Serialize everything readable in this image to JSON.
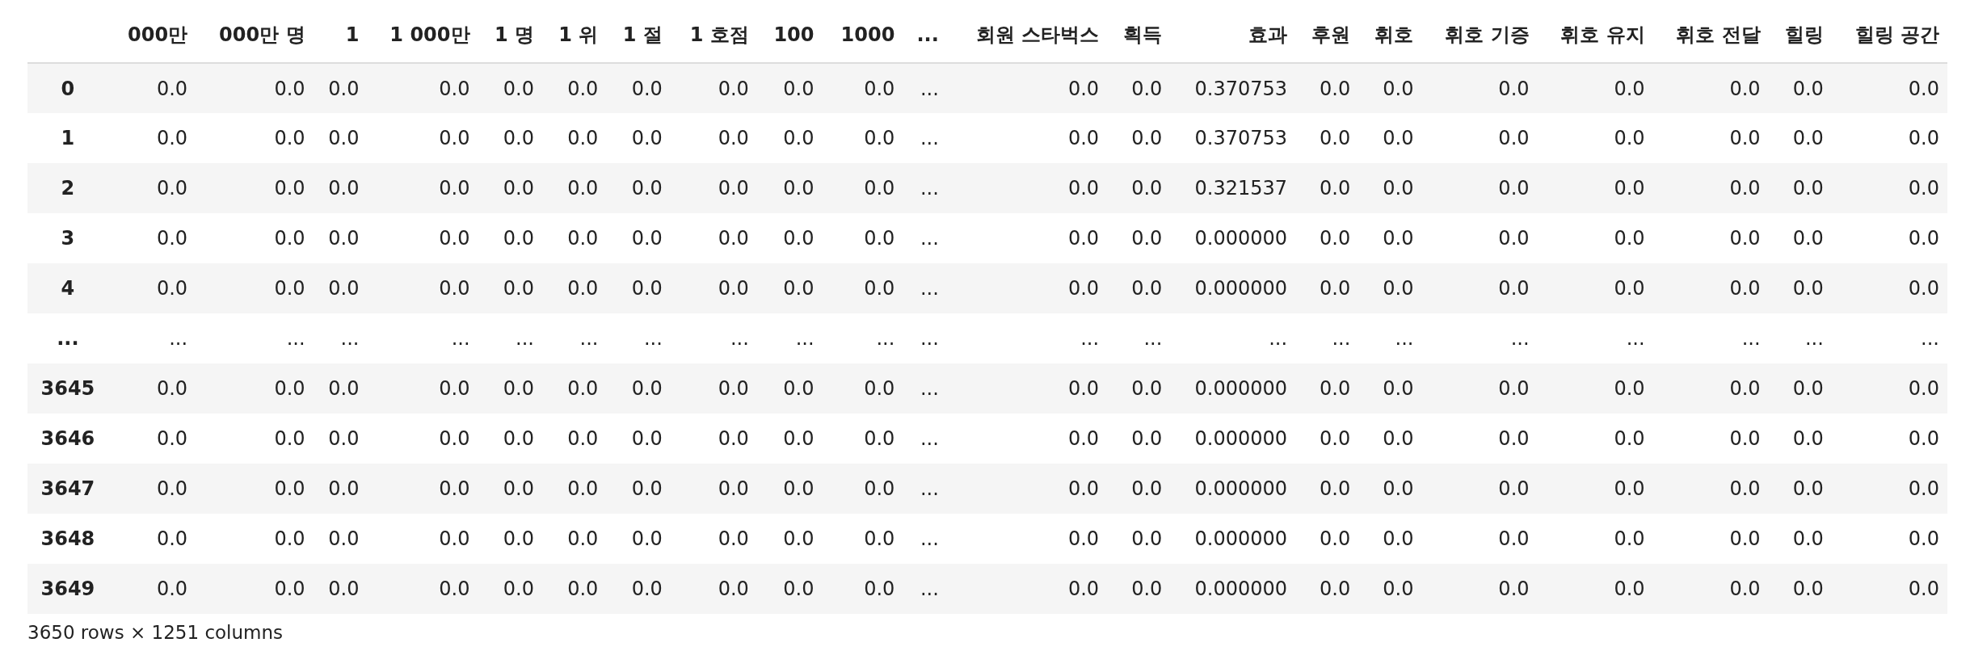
{
  "table": {
    "columns": [
      "000만",
      "000만 명",
      "1",
      "1 000만",
      "1 명",
      "1 위",
      "1 절",
      "1 호점",
      "100",
      "1000",
      "...",
      "회원 스타벅스",
      "획득",
      "효과",
      "후원",
      "휘호",
      "휘호 기증",
      "휘호 유지",
      "휘호 전달",
      "힐링",
      "힐링 공간"
    ],
    "rows": [
      {
        "index": "0",
        "cells": [
          "0.0",
          "0.0",
          "0.0",
          "0.0",
          "0.0",
          "0.0",
          "0.0",
          "0.0",
          "0.0",
          "0.0",
          "...",
          "0.0",
          "0.0",
          "0.370753",
          "0.0",
          "0.0",
          "0.0",
          "0.0",
          "0.0",
          "0.0",
          "0.0"
        ]
      },
      {
        "index": "1",
        "cells": [
          "0.0",
          "0.0",
          "0.0",
          "0.0",
          "0.0",
          "0.0",
          "0.0",
          "0.0",
          "0.0",
          "0.0",
          "...",
          "0.0",
          "0.0",
          "0.370753",
          "0.0",
          "0.0",
          "0.0",
          "0.0",
          "0.0",
          "0.0",
          "0.0"
        ]
      },
      {
        "index": "2",
        "cells": [
          "0.0",
          "0.0",
          "0.0",
          "0.0",
          "0.0",
          "0.0",
          "0.0",
          "0.0",
          "0.0",
          "0.0",
          "...",
          "0.0",
          "0.0",
          "0.321537",
          "0.0",
          "0.0",
          "0.0",
          "0.0",
          "0.0",
          "0.0",
          "0.0"
        ]
      },
      {
        "index": "3",
        "cells": [
          "0.0",
          "0.0",
          "0.0",
          "0.0",
          "0.0",
          "0.0",
          "0.0",
          "0.0",
          "0.0",
          "0.0",
          "...",
          "0.0",
          "0.0",
          "0.000000",
          "0.0",
          "0.0",
          "0.0",
          "0.0",
          "0.0",
          "0.0",
          "0.0"
        ]
      },
      {
        "index": "4",
        "cells": [
          "0.0",
          "0.0",
          "0.0",
          "0.0",
          "0.0",
          "0.0",
          "0.0",
          "0.0",
          "0.0",
          "0.0",
          "...",
          "0.0",
          "0.0",
          "0.000000",
          "0.0",
          "0.0",
          "0.0",
          "0.0",
          "0.0",
          "0.0",
          "0.0"
        ]
      },
      {
        "index": "...",
        "cells": [
          "...",
          "...",
          "...",
          "...",
          "...",
          "...",
          "...",
          "...",
          "...",
          "...",
          "...",
          "...",
          "...",
          "...",
          "...",
          "...",
          "...",
          "...",
          "...",
          "...",
          "..."
        ]
      },
      {
        "index": "3645",
        "cells": [
          "0.0",
          "0.0",
          "0.0",
          "0.0",
          "0.0",
          "0.0",
          "0.0",
          "0.0",
          "0.0",
          "0.0",
          "...",
          "0.0",
          "0.0",
          "0.000000",
          "0.0",
          "0.0",
          "0.0",
          "0.0",
          "0.0",
          "0.0",
          "0.0"
        ]
      },
      {
        "index": "3646",
        "cells": [
          "0.0",
          "0.0",
          "0.0",
          "0.0",
          "0.0",
          "0.0",
          "0.0",
          "0.0",
          "0.0",
          "0.0",
          "...",
          "0.0",
          "0.0",
          "0.000000",
          "0.0",
          "0.0",
          "0.0",
          "0.0",
          "0.0",
          "0.0",
          "0.0"
        ]
      },
      {
        "index": "3647",
        "cells": [
          "0.0",
          "0.0",
          "0.0",
          "0.0",
          "0.0",
          "0.0",
          "0.0",
          "0.0",
          "0.0",
          "0.0",
          "...",
          "0.0",
          "0.0",
          "0.000000",
          "0.0",
          "0.0",
          "0.0",
          "0.0",
          "0.0",
          "0.0",
          "0.0"
        ]
      },
      {
        "index": "3648",
        "cells": [
          "0.0",
          "0.0",
          "0.0",
          "0.0",
          "0.0",
          "0.0",
          "0.0",
          "0.0",
          "0.0",
          "0.0",
          "...",
          "0.0",
          "0.0",
          "0.000000",
          "0.0",
          "0.0",
          "0.0",
          "0.0",
          "0.0",
          "0.0",
          "0.0"
        ]
      },
      {
        "index": "3649",
        "cells": [
          "0.0",
          "0.0",
          "0.0",
          "0.0",
          "0.0",
          "0.0",
          "0.0",
          "0.0",
          "0.0",
          "0.0",
          "...",
          "0.0",
          "0.0",
          "0.000000",
          "0.0",
          "0.0",
          "0.0",
          "0.0",
          "0.0",
          "0.0",
          "0.0"
        ]
      }
    ]
  },
  "footer": "3650 rows × 1251 columns"
}
